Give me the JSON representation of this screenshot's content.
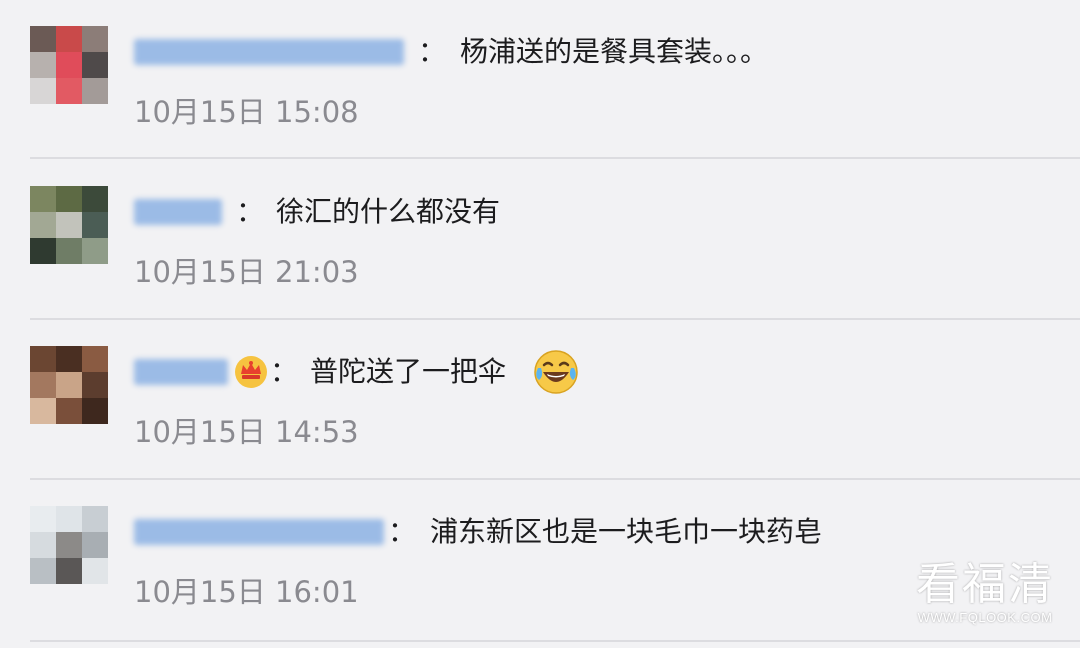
{
  "comments": [
    {
      "colon": "：",
      "text": "杨浦送的是餐具套装。。。",
      "time": "10月15日 15:08",
      "avatar_colors": [
        "#6b5a55",
        "#c94a4a",
        "#e04c5a",
        "#8c7d78",
        "#b7b1ae",
        "#4f4a4a"
      ]
    },
    {
      "colon": "：",
      "text": "徐汇的什么都没有",
      "time": "10月15日 21:03",
      "avatar_colors": [
        "#7c8660",
        "#5d6a44",
        "#a2a894",
        "#3c4a3a",
        "#c2c3bb",
        "#4b5d55"
      ]
    },
    {
      "colon": "：",
      "text": "普陀送了一把伞",
      "time": "10月15日 14:53",
      "avatar_colors": [
        "#6b4632",
        "#a3785f",
        "#4a2f22",
        "#c9a488",
        "#8a5b42",
        "#5c3d2e"
      ],
      "badge_icon": "crown-emoji-icon",
      "end_icon": "laughing-tears-emoji-icon"
    },
    {
      "colon": "：",
      "text": "浦东新区也是一块毛巾一块药皂",
      "time": "10月15日 16:01",
      "avatar_colors": [
        "#e8ecef",
        "#dfe4e8",
        "#8c8a88",
        "#5a5756",
        "#c8ced3",
        "#a8aeb3"
      ]
    }
  ],
  "watermark": {
    "title": "看福清",
    "url": "WWW.FQLOOK.COM"
  },
  "colors": {
    "background": "#f2f2f4",
    "text": "#1c1c1e",
    "time": "#8a8a90",
    "name_blur": "#9bbbe6",
    "divider": "#dcdce0"
  }
}
